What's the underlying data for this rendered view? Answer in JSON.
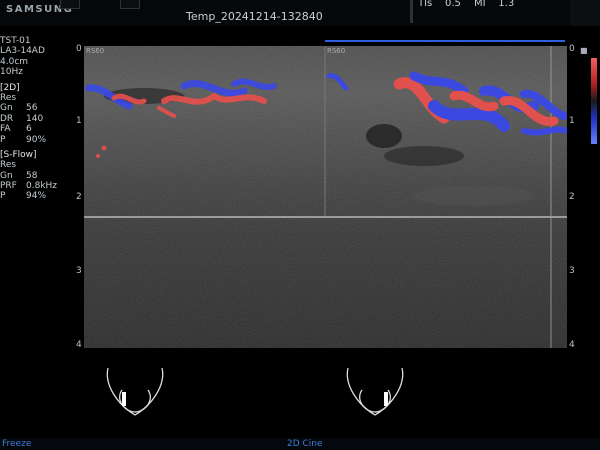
{
  "header": {
    "brand": "SAMSUNG",
    "filename": "Temp_20241214-132840",
    "tis_label": "TIs",
    "tis_value": "0.5",
    "mi_label": "MI",
    "mi_value": "1.3"
  },
  "params": {
    "lines": [
      "TST-01",
      "LA3-14AD",
      "4.0cm",
      "10Hz"
    ],
    "section_2d": "[2D]",
    "res_2d": "Res",
    "items_2d": [
      {
        "k": "Gn",
        "v": "56"
      },
      {
        "k": "DR",
        "v": "140"
      },
      {
        "k": "FA",
        "v": "6"
      },
      {
        "k": "P",
        "v": "90%"
      }
    ],
    "section_flow": "[S-Flow]",
    "res_flow": "Res",
    "items_flow": [
      {
        "k": "Gn",
        "v": "58"
      },
      {
        "k": "PRF",
        "v": "0.8kHz"
      },
      {
        "k": "P",
        "v": "94%"
      }
    ]
  },
  "left_panel_label": "RS60",
  "right_panel_label": "RS60",
  "depth_scale": [
    "0",
    "1",
    "2",
    "3",
    "4"
  ],
  "footer": {
    "freeze": "Freeze",
    "cine": "2D Cine"
  },
  "colors": {
    "flow_red": "#e8504c",
    "flow_blue": "#3a48e8",
    "status_blue": "#3e7cd6",
    "bar_blue": "#2f5ee0"
  }
}
